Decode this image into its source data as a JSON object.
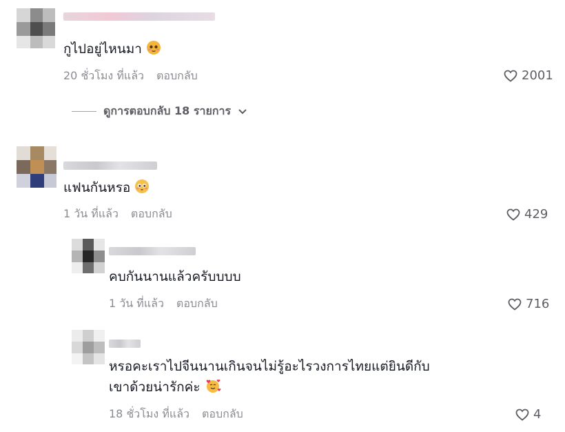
{
  "comments": [
    {
      "text": "กูไปอยู่ไหนมา",
      "time": "20 ชั่วโมง ที่แล้ว",
      "reply_label": "ตอบกลับ",
      "likes": "2001",
      "view_replies": "ดูการตอบกลับ 18 รายการ",
      "emoji": "face-emoji"
    },
    {
      "text": "แฟนกันหรอ",
      "time": "1 วัน ที่แล้ว",
      "reply_label": "ตอบกลับ",
      "likes": "429",
      "emoji": "face-emoji",
      "replies": [
        {
          "text": "คบกันนานแล้วครับบบบ",
          "time": "1 วัน ที่แล้ว",
          "reply_label": "ตอบกลับ",
          "likes": "716"
        },
        {
          "text_line1": "หรอคะเราไปจีนนานเกินจนไม่รู้อะไรวงการไทยแต่ยินดีกับ",
          "text_line2": "เขาด้วยน่ารักค่ะ",
          "time": "18 ชั่วโมง ที่แล้ว",
          "reply_label": "ตอบกลับ",
          "likes": "4",
          "emoji": "smiling-face-with-hearts-emoji"
        }
      ]
    }
  ],
  "colors": {
    "text": "#161823",
    "meta": "#8a8b91",
    "like": "#5c5d63"
  }
}
